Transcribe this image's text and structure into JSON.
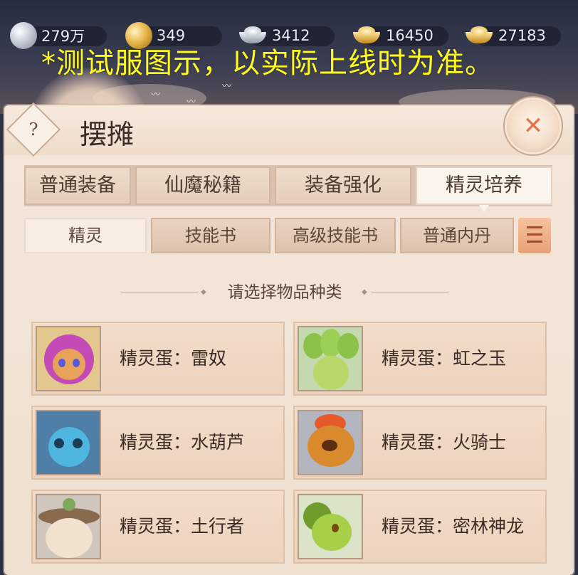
{
  "currencies": [
    {
      "icon": "silver-coin-icon",
      "amount": "279万"
    },
    {
      "icon": "gold-coin-icon",
      "amount": "349"
    },
    {
      "icon": "silver-ingot-icon",
      "amount": "3412"
    },
    {
      "icon": "gold-ingot-icon",
      "amount": "16450"
    },
    {
      "icon": "gold-ingot-icon",
      "amount": "27183"
    }
  ],
  "notice": "*测试服图示，以实际上线时为准。",
  "panel": {
    "title": "摆摊",
    "help_label": "?",
    "close_label": "✕"
  },
  "tabs": [
    {
      "label": "普通装备",
      "active": false
    },
    {
      "label": "仙魔秘籍",
      "active": false
    },
    {
      "label": "装备强化",
      "active": false
    },
    {
      "label": "精灵培养",
      "active": true
    }
  ],
  "subtabs": [
    {
      "label": "精灵",
      "active": true
    },
    {
      "label": "技能书",
      "active": false
    },
    {
      "label": "高级技能书",
      "active": false
    },
    {
      "label": "普通内丹",
      "active": false
    }
  ],
  "section_prompt": "请选择物品种类",
  "items": [
    {
      "name": "精灵蛋：雷奴"
    },
    {
      "name": "精灵蛋：虹之玉"
    },
    {
      "name": "精灵蛋：水葫芦"
    },
    {
      "name": "精灵蛋：火骑士"
    },
    {
      "name": "精灵蛋：土行者"
    },
    {
      "name": "精灵蛋：密林神龙"
    }
  ],
  "colors": {
    "notice": "#fffb1e",
    "panel_bg": "#f3e6d9",
    "accent": "#e8734a"
  }
}
